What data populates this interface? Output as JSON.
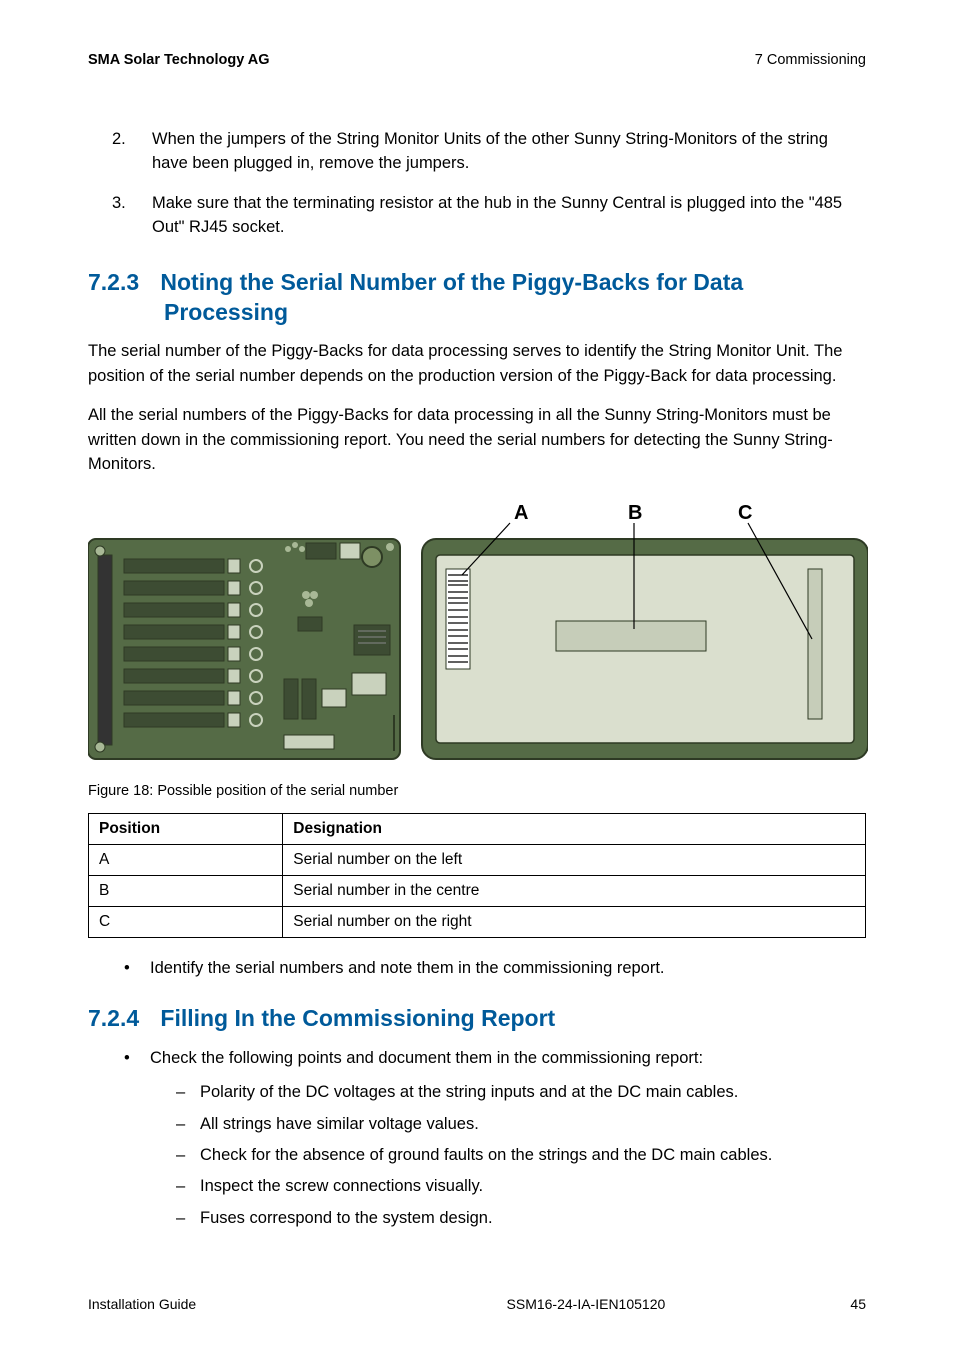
{
  "header": {
    "left": "SMA Solar Technology AG",
    "right": "7 Commissioning"
  },
  "list1": [
    {
      "num": "2.",
      "text": "When the jumpers of the String Monitor Units of the other Sunny String-Monitors of the string have been plugged in, remove the jumpers."
    },
    {
      "num": "3.",
      "text": "Make sure that the terminating resistor at the hub in the Sunny Central is plugged into the \"485 Out\" RJ45 socket."
    }
  ],
  "section723": {
    "num": "7.2.3",
    "title1": "Noting the Serial Number of the Piggy-Backs for Data",
    "title2": "Processing",
    "p1": "The serial number of the Piggy-Backs for data processing serves to identify the String Monitor Unit. The position of the serial number depends on the production version of the Piggy-Back for data processing.",
    "p2": "All the serial numbers of the Piggy-Backs for data processing in all the Sunny String-Monitors must be written down in the commissioning report. You need the serial numbers for detecting the Sunny String-Monitors."
  },
  "figure": {
    "labelA": "A",
    "labelB": "B",
    "labelC": "C",
    "caption": "Figure 18: Possible position of the serial number"
  },
  "table": {
    "headers": {
      "pos": "Position",
      "des": "Designation"
    },
    "rows": [
      {
        "pos": "A",
        "des": "Serial number on the left"
      },
      {
        "pos": "B",
        "des": "Serial number in the centre"
      },
      {
        "pos": "C",
        "des": "Serial number on the right"
      }
    ]
  },
  "bullet1": "Identify the serial numbers and note them in the commissioning report.",
  "section724": {
    "num": "7.2.4",
    "title": "Filling In the Commissioning Report",
    "bullet": "Check the following points and document them in the commissioning report:",
    "dashes": [
      "Polarity of the DC voltages at the string inputs and at the DC main cables.",
      "All strings have similar voltage values.",
      "Check for the absence of ground faults on the strings and the DC main cables.",
      "Inspect the screw connections visually.",
      "Fuses correspond to the system design."
    ]
  },
  "footer": {
    "left": "Installation Guide",
    "center": "SSM16-24-IA-IEN105120",
    "right": "45"
  }
}
